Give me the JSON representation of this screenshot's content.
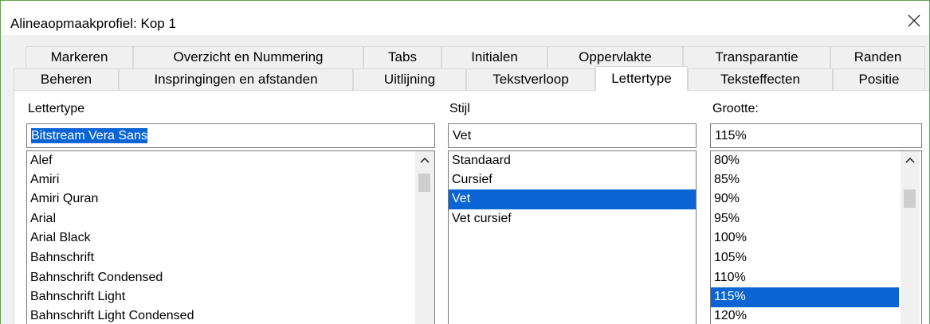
{
  "window": {
    "title": "Alineaopmaakprofiel: Kop 1"
  },
  "tabs_row1": [
    {
      "label": "Markeren"
    },
    {
      "label": "Overzicht en Nummering"
    },
    {
      "label": "Tabs"
    },
    {
      "label": "Initialen"
    },
    {
      "label": "Oppervlakte"
    },
    {
      "label": "Transparantie"
    },
    {
      "label": "Randen"
    }
  ],
  "tabs_row2": [
    {
      "label": "Beheren"
    },
    {
      "label": "Inspringingen en afstanden"
    },
    {
      "label": "Uitlijning"
    },
    {
      "label": "Tekstverloop"
    },
    {
      "label": "Lettertype"
    },
    {
      "label": "Teksteffecten"
    },
    {
      "label": "Positie"
    }
  ],
  "font": {
    "label": "Lettertype",
    "value": "Bitstream Vera Sans",
    "items": [
      "Alef",
      "Amiri",
      "Amiri Quran",
      "Arial",
      "Arial Black",
      "Bahnschrift",
      "Bahnschrift Condensed",
      "Bahnschrift Light",
      "Bahnschrift Light Condensed"
    ]
  },
  "style": {
    "label": "Stijl",
    "value": "Vet",
    "items": [
      "Standaard",
      "Cursief",
      "Vet",
      "Vet cursief"
    ],
    "selected": "Vet"
  },
  "size": {
    "label": "Grootte:",
    "value": "115%",
    "items": [
      "80%",
      "85%",
      "90%",
      "95%",
      "100%",
      "105%",
      "110%",
      "115%",
      "120%"
    ],
    "selected": "115%"
  },
  "colors": {
    "accent": "#0a64d6",
    "window_border": "#5fa04b"
  }
}
